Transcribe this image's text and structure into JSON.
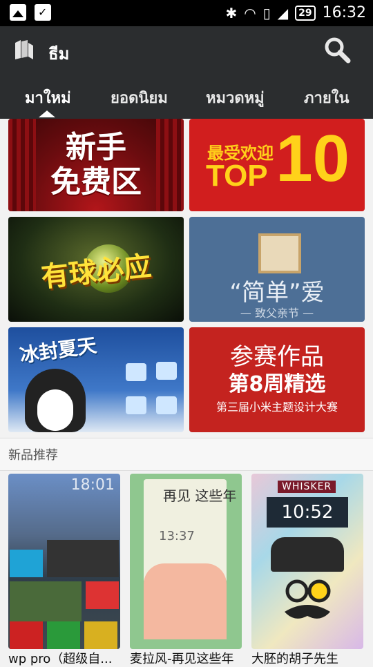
{
  "status_bar": {
    "time": "16:32",
    "battery": "29",
    "icons": [
      "image-icon",
      "bag-check-icon",
      "bluetooth-icon",
      "wifi-icon",
      "vibrate-icon",
      "signal-icon"
    ]
  },
  "app_bar": {
    "title": "ธีม",
    "tabs": [
      {
        "label": "มาใหม่",
        "active": true
      },
      {
        "label": "ยอดนิยม",
        "active": false
      },
      {
        "label": "หมวดหมู่",
        "active": false
      },
      {
        "label": "ภายใน",
        "active": false
      }
    ]
  },
  "banners": [
    {
      "id": "newbie",
      "lines": [
        "新手",
        "免费区"
      ]
    },
    {
      "id": "top10",
      "small": "最受欢迎",
      "big": "TOP",
      "num": "10"
    },
    {
      "id": "football",
      "text": "有球必应"
    },
    {
      "id": "fathers-day",
      "text": "“简单”爱",
      "sub": "— 致父亲节 —"
    },
    {
      "id": "ice-summer",
      "text": "冰封夏天"
    },
    {
      "id": "contest",
      "a": "参赛作品",
      "b": "第8周精选",
      "c": "第三届小米主题设计大赛"
    }
  ],
  "section": {
    "title": "新品推荐"
  },
  "themes": [
    {
      "name": "wp pro（超级自...",
      "clock": "18:01"
    },
    {
      "name": "麦拉风-再见这些年",
      "text": "再见 这些年",
      "time": "13:37"
    },
    {
      "name": "大胚的胡子先生",
      "brand": "WHISKER",
      "time": "10:52"
    }
  ],
  "colors": {
    "app_bar": "#2b2d2f",
    "accent_red": "#d11e1e",
    "accent_yellow": "#ffd21a"
  }
}
